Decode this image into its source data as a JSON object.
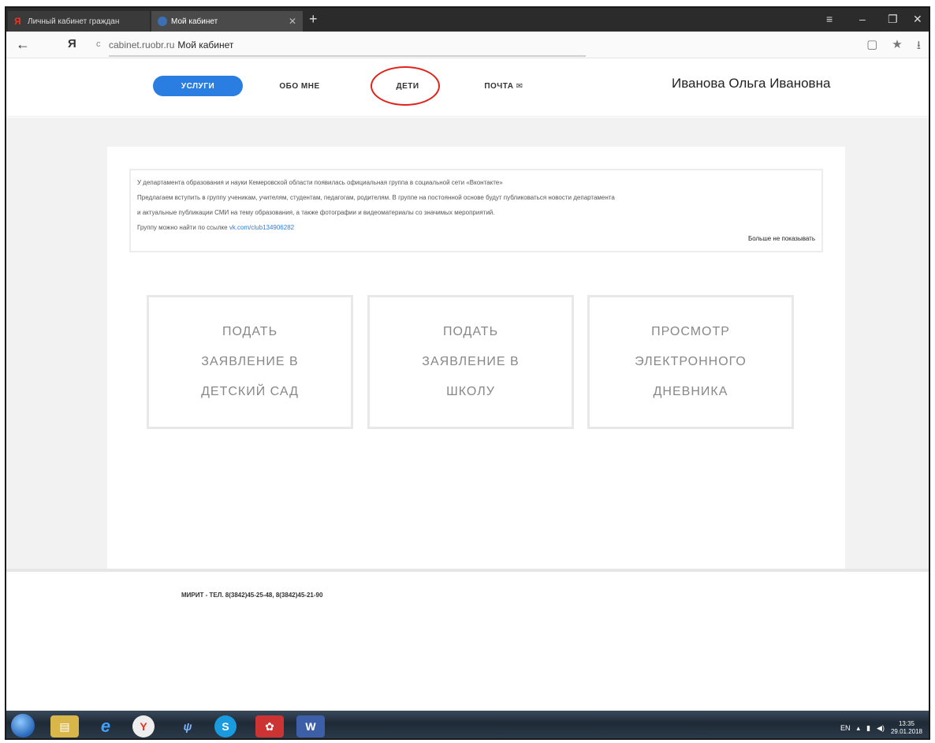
{
  "browser": {
    "tabs": [
      {
        "title": "Личный кабинет граждан",
        "active": false
      },
      {
        "title": "Мой кабинет",
        "active": true
      }
    ],
    "new_tab": "+",
    "address": {
      "host": "cabinet.ruobr.ru",
      "page_title": "Мой кабинет"
    }
  },
  "header": {
    "nav": [
      {
        "label": "УСЛУГИ",
        "active": true
      },
      {
        "label": "ОБО МНЕ"
      },
      {
        "label": "ДЕТИ"
      },
      {
        "label": "ПОЧТА ✉"
      }
    ],
    "user_name": "Иванова Ольга Ивановна"
  },
  "notice": {
    "line1": "У департамента образования и науки Кемеровской области появилась официальная группа в социальной сети «Вконтакте»",
    "line2": "Предлагаем вступить в группу ученикам, учителям, студентам, педагогам, родителям. В группе на постоянной основе будут публиковаться новости департамента",
    "line3": "и актуальные публикации СМИ на тему образования, а также фотографии и видеоматериалы со значимых мероприятий.",
    "line4_prefix": "Группу можно найти по ссылке",
    "link": "vk.com/club134906282",
    "dismiss": "Больше не показывать"
  },
  "cards": [
    {
      "label": "ПОДАТЬ\nЗАЯВЛЕНИЕ В\nДЕТСКИЙ САД"
    },
    {
      "label": "ПОДАТЬ\nЗАЯВЛЕНИЕ В\nШКОЛУ"
    },
    {
      "label": "ПРОСМОТР\nЭЛЕКТРОННОГО\nДНЕВНИКА"
    }
  ],
  "footer": {
    "contact": "МИРИТ - ТЕЛ. 8(3842)45-25-48, 8(3842)45-21-90"
  },
  "taskbar": {
    "lang": "EN",
    "time": "13:35",
    "date": "29.01.2018"
  }
}
